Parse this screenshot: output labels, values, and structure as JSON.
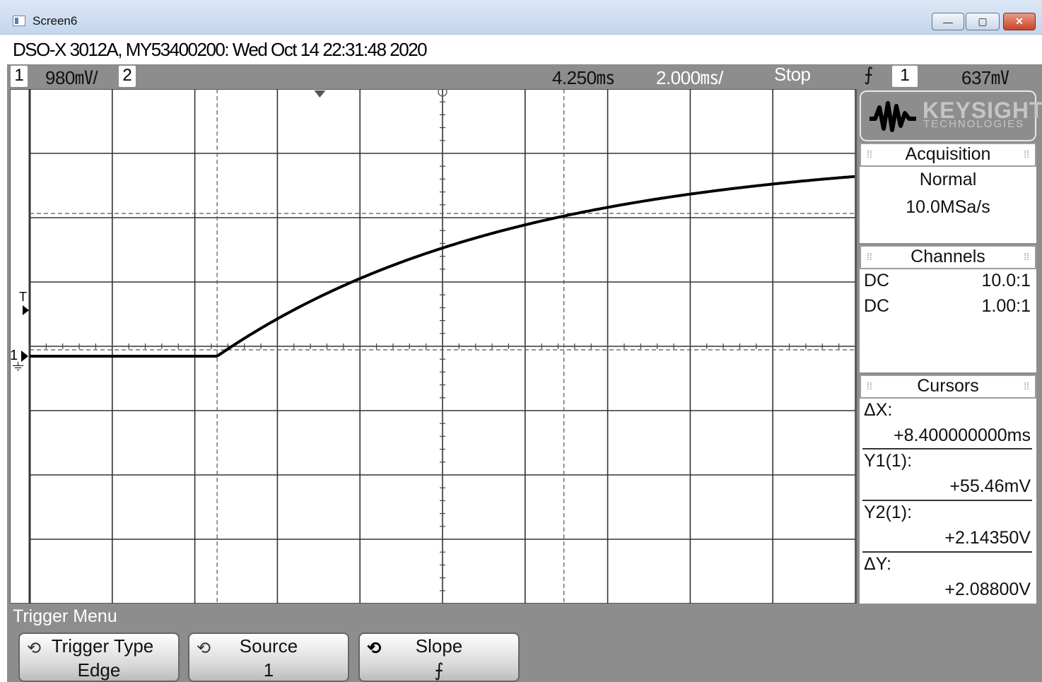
{
  "window": {
    "title": "Screen6",
    "minimize_glyph": "—",
    "maximize_glyph": "▢",
    "close_glyph": "✕"
  },
  "header": {
    "text": "DSO-X 3012A, MY53400200: Wed Oct 14 22:31:48 2020"
  },
  "status": {
    "ch1_label": "1",
    "ch1_scale": "980㎷/",
    "ch2_label": "2",
    "time_delay": "4.250㎳",
    "time_scale": "2.000㎳/",
    "run_state": "Stop",
    "trigger_slope_glyph": "⨍",
    "trigger_source": "1",
    "trigger_level": "637㎷"
  },
  "markers": {
    "trigger_time_marker": "T",
    "ch1_ground_marker": "1"
  },
  "logo": {
    "brand": "KEYSIGHT",
    "sub": "TECHNOLOGIES"
  },
  "acquisition": {
    "heading": "Acquisition",
    "mode": "Normal",
    "sample_rate": "10.0MSa/s"
  },
  "channels": {
    "heading": "Channels",
    "rows": [
      {
        "coupling": "DC",
        "probe": "10.0:1"
      },
      {
        "coupling": "DC",
        "probe": "1.00:1"
      }
    ]
  },
  "cursors": {
    "heading": "Cursors",
    "dx_label": "ΔX:",
    "dx_value": "+8.400000000ms",
    "y1_label": "Y1(1):",
    "y1_value": "+55.46mV",
    "y2_label": "Y2(1):",
    "y2_value": "+2.14350V",
    "dy_label": "ΔY:",
    "dy_value": "+2.08800V"
  },
  "trigger_menu": {
    "title": "Trigger Menu",
    "softkeys": [
      {
        "label": "Trigger Type",
        "value": "Edge"
      },
      {
        "label": "Source",
        "value": "1"
      },
      {
        "label": "Slope",
        "value": "⨍"
      }
    ]
  },
  "colors": {
    "frame": "#8d8d8d",
    "trace": "#000000",
    "grid": "#333333"
  },
  "waveform": {
    "description_units": "divisions",
    "rise_start_div_x": 2.27,
    "flat_level_div_y": -0.04,
    "final_level_div_y": 4.7,
    "time_constant_div": 3.6
  }
}
